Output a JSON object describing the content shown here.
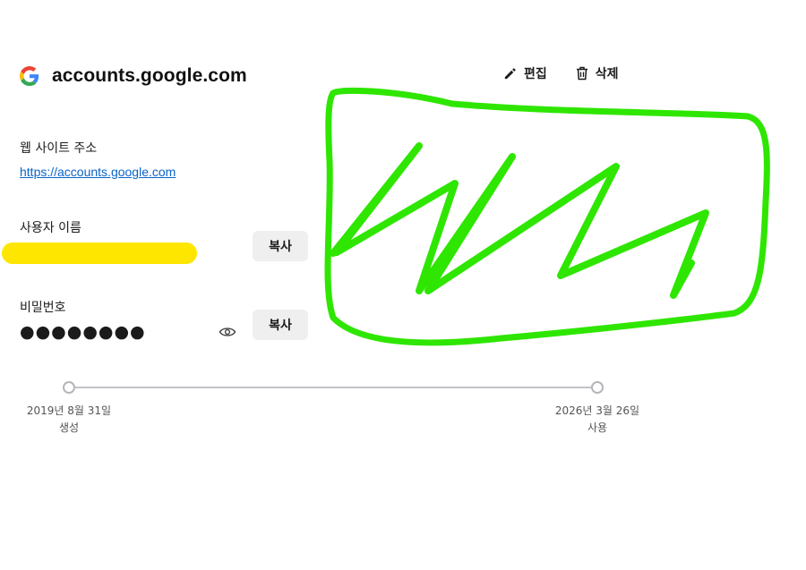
{
  "header": {
    "site_title": "accounts.google.com",
    "logo_icon": "google-logo-icon",
    "edit_label": "편집",
    "edit_icon": "pencil-icon",
    "delete_label": "삭제",
    "delete_icon": "trash-icon"
  },
  "website": {
    "label": "웹 사이트 주소",
    "url": "https://accounts.google.com"
  },
  "username": {
    "label": "사용자 이름",
    "copy_label": "복사"
  },
  "password": {
    "label": "비밀번호",
    "masked_value": "●●●●●●●●",
    "reveal_icon": "eye-icon",
    "copy_label": "복사"
  },
  "timeline": {
    "created_date": "2019년 8월 31일",
    "created_label": "생성",
    "used_date": "2026년 3월 26일",
    "used_label": "사용"
  },
  "colors": {
    "highlight_yellow": "#ffe600",
    "scribble_green": "#2ee600",
    "link_blue": "#0a63c9"
  }
}
